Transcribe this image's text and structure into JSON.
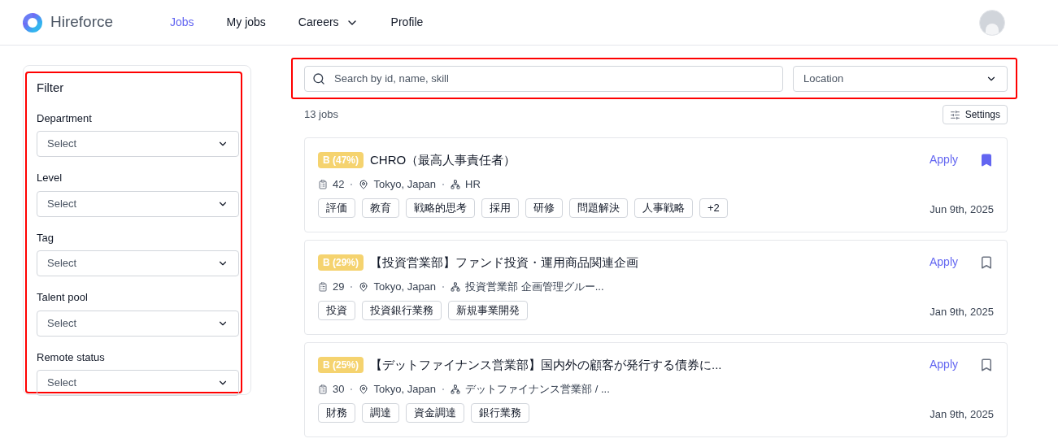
{
  "brand": "Hireforce",
  "nav": [
    {
      "label": "Jobs",
      "selected": true,
      "dropdown": false
    },
    {
      "label": "My jobs",
      "selected": false,
      "dropdown": false
    },
    {
      "label": "Careers",
      "selected": false,
      "dropdown": true
    },
    {
      "label": "Profile",
      "selected": false,
      "dropdown": false
    }
  ],
  "filter": {
    "title": "Filter",
    "fields": [
      {
        "label": "Department",
        "placeholder": "Select"
      },
      {
        "label": "Level",
        "placeholder": "Select"
      },
      {
        "label": "Tag",
        "placeholder": "Select"
      },
      {
        "label": "Talent pool",
        "placeholder": "Select"
      },
      {
        "label": "Remote status",
        "placeholder": "Select"
      }
    ]
  },
  "search": {
    "placeholder": "Search by id, name, skill"
  },
  "location": {
    "placeholder": "Location"
  },
  "count": "13 jobs",
  "settings_button": "Settings",
  "jobs": [
    {
      "score": "B (47%)",
      "title": "CHRO（最高人事責任者）",
      "applicants": "42",
      "location": "Tokyo, Japan",
      "department": "HR",
      "tags": [
        "評価",
        "教育",
        "戦略的思考",
        "採用",
        "研修",
        "問題解決",
        "人事戦略",
        "+2"
      ],
      "apply": "Apply",
      "saved": true,
      "date": "Jun 9th, 2025"
    },
    {
      "score": "B (29%)",
      "title": "【投資営業部】ファンド投資・運用商品関連企画",
      "applicants": "29",
      "location": "Tokyo, Japan",
      "department": "投資営業部 企画管理グルー...",
      "tags": [
        "投資",
        "投資銀行業務",
        "新規事業開発"
      ],
      "apply": "Apply",
      "saved": false,
      "date": "Jan 9th, 2025"
    },
    {
      "score": "B (25%)",
      "title": "【デットファイナンス営業部】国内外の顧客が発行する債券に...",
      "applicants": "30",
      "location": "Tokyo, Japan",
      "department": "デットファイナンス営業部 / ...",
      "tags": [
        "財務",
        "調達",
        "資金調達",
        "銀行業務"
      ],
      "apply": "Apply",
      "saved": false,
      "date": "Jan 9th, 2025"
    }
  ]
}
